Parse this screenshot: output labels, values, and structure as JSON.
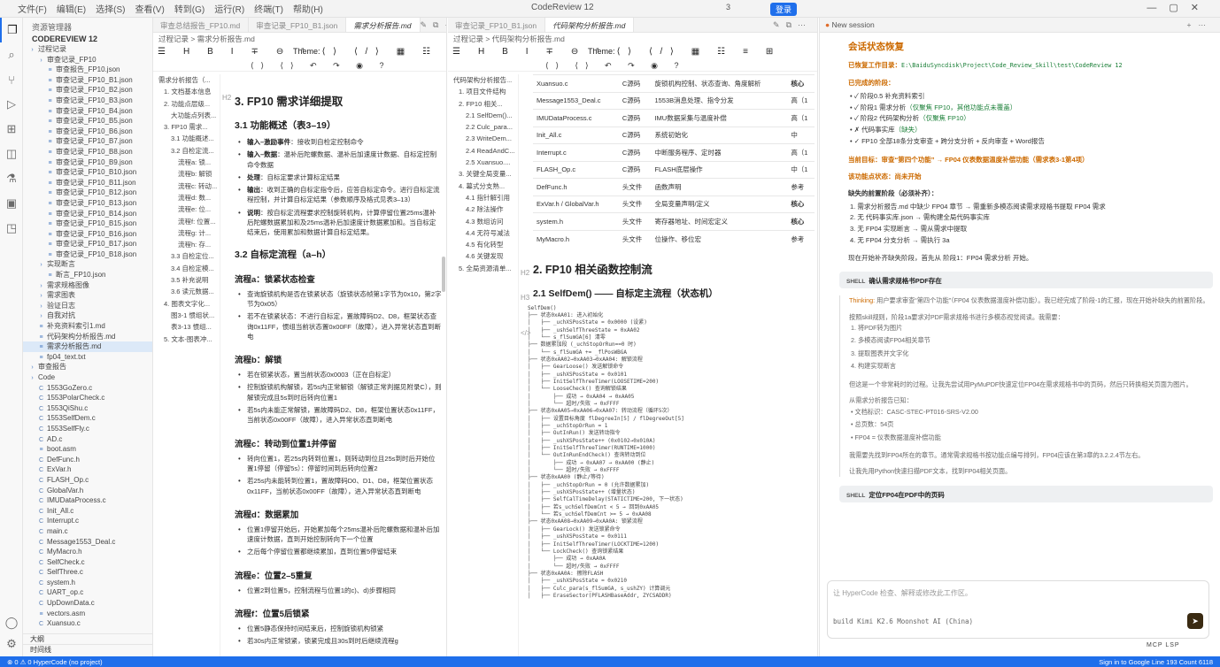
{
  "titlebar": {
    "menus": [
      "文件(F)",
      "编辑(E)",
      "选择(S)",
      "查看(V)",
      "转到(G)",
      "运行(R)",
      "终端(T)",
      "帮助(H)"
    ],
    "title": "CodeReview 12",
    "ext_count": "3",
    "badge": "登录"
  },
  "explorer": {
    "header": "资源管理器",
    "workspace": "CODEREVIEW 12",
    "tree": [
      {
        "label": "过程记录",
        "indent": 0,
        "kind": "folder"
      },
      {
        "label": "审查记录_FP10",
        "indent": 1,
        "kind": "folder"
      },
      {
        "label": "审查报告_FP10.json",
        "indent": 2,
        "kind": "file"
      },
      {
        "label": "审查记录_FP10_B1.json",
        "indent": 2,
        "kind": "file"
      },
      {
        "label": "审查记录_FP10_B2.json",
        "indent": 2,
        "kind": "file"
      },
      {
        "label": "审查记录_FP10_B3.json",
        "indent": 2,
        "kind": "file"
      },
      {
        "label": "审查记录_FP10_B4.json",
        "indent": 2,
        "kind": "file"
      },
      {
        "label": "审查记录_FP10_B5.json",
        "indent": 2,
        "kind": "file"
      },
      {
        "label": "审查记录_FP10_B6.json",
        "indent": 2,
        "kind": "file"
      },
      {
        "label": "审查记录_FP10_B7.json",
        "indent": 2,
        "kind": "file"
      },
      {
        "label": "审查记录_FP10_B8.json",
        "indent": 2,
        "kind": "file"
      },
      {
        "label": "审查记录_FP10_B9.json",
        "indent": 2,
        "kind": "file"
      },
      {
        "label": "审查记录_FP10_B10.json",
        "indent": 2,
        "kind": "file"
      },
      {
        "label": "审查记录_FP10_B11.json",
        "indent": 2,
        "kind": "file"
      },
      {
        "label": "审查记录_FP10_B12.json",
        "indent": 2,
        "kind": "file"
      },
      {
        "label": "审查记录_FP10_B13.json",
        "indent": 2,
        "kind": "file"
      },
      {
        "label": "审查记录_FP10_B14.json",
        "indent": 2,
        "kind": "file"
      },
      {
        "label": "审查记录_FP10_B15.json",
        "indent": 2,
        "kind": "file"
      },
      {
        "label": "审查记录_FP10_B16.json",
        "indent": 2,
        "kind": "file"
      },
      {
        "label": "审查记录_FP10_B17.json",
        "indent": 2,
        "kind": "file"
      },
      {
        "label": "审查记录_FP10_B18.json",
        "indent": 2,
        "kind": "file"
      },
      {
        "label": "实现断言",
        "indent": 1,
        "kind": "folder"
      },
      {
        "label": "断言_FP10.json",
        "indent": 2,
        "kind": "file"
      },
      {
        "label": "需求规格图像",
        "indent": 1,
        "kind": "folder"
      },
      {
        "label": "需求图表",
        "indent": 1,
        "kind": "folder"
      },
      {
        "label": "验证日志",
        "indent": 1,
        "kind": "folder"
      },
      {
        "label": "自我对抗",
        "indent": 1,
        "kind": "folder"
      },
      {
        "label": "补充资料索引1.md",
        "indent": 1,
        "kind": "file"
      },
      {
        "label": "代码架构分析报告.md",
        "indent": 1,
        "kind": "file"
      },
      {
        "label": "需求分析报告.md",
        "indent": 1,
        "kind": "file",
        "selected": true
      },
      {
        "label": "fp04_text.txt",
        "indent": 1,
        "kind": "file"
      },
      {
        "label": "审查报告",
        "indent": 0,
        "kind": "folder"
      },
      {
        "label": "Code",
        "indent": 0,
        "kind": "folder"
      },
      {
        "label": "1553GoZero.c",
        "indent": 1,
        "kind": "c"
      },
      {
        "label": "1553PolarCheck.c",
        "indent": 1,
        "kind": "c"
      },
      {
        "label": "1553QiShu.c",
        "indent": 1,
        "kind": "c"
      },
      {
        "label": "1553SelfDem.c",
        "indent": 1,
        "kind": "c"
      },
      {
        "label": "1553SelfFly.c",
        "indent": 1,
        "kind": "c"
      },
      {
        "label": "AD.c",
        "indent": 1,
        "kind": "c"
      },
      {
        "label": "boot.asm",
        "indent": 1,
        "kind": "file"
      },
      {
        "label": "DefFunc.h",
        "indent": 1,
        "kind": "c"
      },
      {
        "label": "ExVar.h",
        "indent": 1,
        "kind": "c"
      },
      {
        "label": "FLASH_Op.c",
        "indent": 1,
        "kind": "c"
      },
      {
        "label": "GlobalVar.h",
        "indent": 1,
        "kind": "c"
      },
      {
        "label": "IMUDataProcess.c",
        "indent": 1,
        "kind": "c"
      },
      {
        "label": "Init_All.c",
        "indent": 1,
        "kind": "c"
      },
      {
        "label": "Interrupt.c",
        "indent": 1,
        "kind": "c"
      },
      {
        "label": "main.c",
        "indent": 1,
        "kind": "c"
      },
      {
        "label": "Message1553_Deal.c",
        "indent": 1,
        "kind": "c"
      },
      {
        "label": "MyMacro.h",
        "indent": 1,
        "kind": "c"
      },
      {
        "label": "SelfCheck.c",
        "indent": 1,
        "kind": "c"
      },
      {
        "label": "SelfThree.c",
        "indent": 1,
        "kind": "c"
      },
      {
        "label": "system.h",
        "indent": 1,
        "kind": "c"
      },
      {
        "label": "UART_op.c",
        "indent": 1,
        "kind": "c"
      },
      {
        "label": "UpDownData.c",
        "indent": 1,
        "kind": "c"
      },
      {
        "label": "vectors.asm",
        "indent": 1,
        "kind": "file"
      },
      {
        "label": "Xuansuo.c",
        "indent": 1,
        "kind": "c"
      }
    ],
    "sections": [
      "大纲",
      "时间线"
    ]
  },
  "editor1": {
    "tabs": [
      "审查总结报告_FP10.md",
      "审查记录_FP10_B1.json",
      "需求分析报告.md"
    ],
    "breadcrumb": "过程记录 > 需求分析报告.md",
    "theme_label": "Theme:",
    "toolbar_row1": "☰ H B I ∓ ⊖ “ ⟨⟩ ⟨/⟩ ▦ ☷ ≡ ⊞",
    "toolbar_row2": "⟨⟩ ⟨⟩ ↶ ↷ ◉ ?",
    "outline": [
      "需求分析报告（...",
      "1. 文档基本信息",
      "2. 功能点层级...",
      "大功能点列表...",
      "3. FP10 需求...",
      "3.1 功能概述...",
      "3.2 自检定流...",
      "流程a: 锁...",
      "流程b: 解锁",
      "流程c: 转动...",
      "流程d: 数...",
      "流程e: 位...",
      "流程f: 位置...",
      "流程g: 计...",
      "流程h: 存...",
      "3.3 自检定位...",
      "3.4 自检定模...",
      "3.5 补充说明",
      "3.6 读元数据...",
      "4. 图表文字化...",
      "图3-1 惯组状...",
      "表3-13 惯组...",
      "5. 文本-图表冲..."
    ],
    "heading_main": "3. FP10 需求详细提取",
    "heading_sub1": "3.1 功能概述（表3–19）",
    "overview": [
      {
        "k": "输入–激励事件",
        "v": "：接收到自检定控制命令"
      },
      {
        "k": "输入–数据",
        "v": "：温补后陀螺数据、温补后加速度计数据、自标定控制命令数据"
      },
      {
        "k": "处理",
        "v": "：自标定要求计算标定结果"
      },
      {
        "k": "输出",
        "v": "：收到正确的自标定指令后，应答自标定命令。进行自标定流程控制，并计算自标定结果（参数顺序及格式见表3–13）"
      },
      {
        "k": "说明",
        "v": "：按自标定流程要求控制旋转机构，计算停留位置25ms温补后陀螺数据累加和及25ms温补后加速度计数据累加和。当自标定结束后，使用累加和数据计算自标定结果。"
      }
    ],
    "heading_sub2": "3.2 自标定流程（a–h）",
    "flows": [
      {
        "title": "流程a：锁紧状态检查",
        "items": [
          "查询旋锁机构是否在锁紧状态（旋锁状态帧第1字节为0x10，第2字节为0x05）",
          "若不在锁紧状态：不进行自标定，置故障码D2、D8，框架状态查询0x11FF，惯组当前状态置0x00FF（故障），进入异常状态直到断电"
        ]
      },
      {
        "title": "流程b：解锁",
        "items": [
          "若在锁紧状态，置当前状态0x0003（正在自标定）",
          "控制旋锁机构解锁，若5s内正常解锁（解锁正常判据见附录C），则解锁完成且5s到时后转向位置1",
          "若5s内未能正常解锁，置故障码D2、D8，框架位置状态0x11FF，当前状态0x00FF（故障），进入异常状态直到断电"
        ]
      },
      {
        "title": "流程c：转动到位置1并停留",
        "items": [
          "转向位置1，若25s内转到位置1，则转动到位且25s到时后开始位置1停留（停留5s）：停留时间到后转向位置2",
          "若25s内未能转到位置1，置故障码D0、D1、D8，框架位置状态0x11FF，当前状态0x00FF（故障），进入异常状态直到断电"
        ]
      },
      {
        "title": "流程d：数据累加",
        "items": [
          "位置1停留开始后，开始累加每个25ms温补后陀螺数据和温补后加速度计数据，直到开始控制转向下一个位置",
          "之后每个停留位置都继续累加，直到位置5停留结束"
        ]
      },
      {
        "title": "流程e：位置2–5重复",
        "items": [
          "位置2到位置5，控制流程与位置1的c)、d)步骤相同"
        ]
      },
      {
        "title": "流程f：位置5后锁紧",
        "items": [
          "位置5静态保持时间结束后，控制旋锁机构锁紧",
          "若30s内正常锁紧，锁紧完成且30s到时后继续流程g"
        ]
      }
    ]
  },
  "editor2": {
    "tabs": [
      "审查记录_FP10_B1.json",
      "代码架构分析报告.md"
    ],
    "breadcrumb": "过程记录 > 代码架构分析报告.md",
    "outline": [
      "代码架构分析报告...",
      "1. 项目文件结构",
      "2. FP10 相关...",
      "2.1 SelfDem()...",
      "2.2 Culc_para...",
      "2.3 WriteDem...",
      "2.4 ReadAndC...",
      "2.5 Xuansuo....",
      "3. 关键全局变量...",
      "4. 幕式分支熟...",
      "4.1 指针解引用",
      "4.2 除法操作",
      "4.3 数组访问",
      "4.4 无符号减法",
      "4.5 有化转型",
      "4.6 关键发现",
      "5. 全局资源清单..."
    ],
    "table_rows": [
      [
        "Xuansuo.c",
        "C源码",
        "旋锁机构控制、状态查询、角度解析",
        "核心"
      ],
      [
        "Message1553_Deal.c",
        "C源码",
        "1553B消息处理、指令分发",
        "高（1"
      ],
      [
        "IMUDataProcess.c",
        "C源码",
        "IMU数据采集与温度补偿",
        "高（1"
      ],
      [
        "Init_All.c",
        "C源码",
        "系统初始化",
        "中"
      ],
      [
        "Interrupt.c",
        "C源码",
        "中断服务程序、定时器",
        "高（1"
      ],
      [
        "FLASH_Op.c",
        "C源码",
        "FLASH底层操作",
        "中（1"
      ],
      [
        "DefFunc.h",
        "头文件",
        "函数声明",
        "参考"
      ],
      [
        "ExVar.h / GlobalVar.h",
        "头文件",
        "全局变量声明/定义",
        "核心"
      ],
      [
        "system.h",
        "头文件",
        "寄存器地址、时间宏定义",
        "核心"
      ],
      [
        "MyMacro.h",
        "头文件",
        "位操作、移位宏",
        "参考"
      ]
    ],
    "heading_2": "2. FP10 相关函数控制流",
    "heading_21": "2.1 SelfDem() —— 自标定主流程（状态机）",
    "code": "SelfDem()\n├── 状态0xAA01: 进入初始化\n│   ├── _uchXSPosState = 0x0000 (设紧)\n│   ├── _ushSelfThreeState = 0xAA02\n│   └── s_flSumGA[6] 清零\n├── 数据累加段 (_uchStopOrRun==0 时)\n│   └── s_flSumGA += _flPosWBGA\n├── 状态0xAA02→0xAA03→0xAA04: 解锁流程\n│   ├── GearLoose() 发送解锁命令\n│   ├── _ushXSPosState = 0x0101\n│   ├── InitSelfThreeTimer(LOOSETIME=200)\n│   └── LooseCheck() 查询解锁结果\n│       ├── 成功 → 0xAA04 → 0xAA05\n│       └── 超时/失败 → 0xFFFF\n├── 状态0xAA05→0xAA06→0xAA07: 转动流程（循环5次）\n│   ├── 设置目标角度 flDegreeIn[5] / flDegreeOut[5]\n│   ├── _uchStopOrRun = 1\n│   ├── OutInRun() 发送转动指令\n│   ├── _ushXSPosState++ (0x0102→0x010A)\n│   ├── InitSelfThreeTimer(RUNTIME=1000)\n│   └── OutInRunEndCheck() 查询转动到位\n│       ├── 成功 → 0xAA07 → 0xAA00 (静止)\n│       └── 超时/失败 → 0xFFFF\n├── 状态0xAA00 (静止/等待)\n│   ├── _uchStopOrRun = 0 (允许数据累加)\n│   ├── _ushXSPosState++ (增量状态)\n│   ├── SelfCalTimeDelay(STATICTIME=200, 下一状态)\n│   ├── 若s_uchSelfDemCnt < 5 → 回到0xAA05\n│   └── 若s_uchSelfDemCnt >= 5 → 0xAA08\n├── 状态0xAA08→0xAA09→0xAA0A: 锁紧流程\n│   ├── GearLock() 发送锁紧命令\n│   ├── _ushXSPosState = 0x0111\n│   ├── InitSelfThreeTimer(LOCKTIME=1200)\n│   └── LockCheck() 查询锁紧结果\n│       ├── 成功 → 0xAA0A\n│       └── 超时/失败 → 0xFFFF\n├── 状态0xAA0A: 擦除FLASH\n│   ├── _ushXSPosState = 0x0210\n│   ├── Culc_para(s_flSumGA, s_ushZY) 计算调元\n│   ├── EraseSector(PFLASHBaseAddr, ZYCSADDR)"
  },
  "chat": {
    "tab": "New session",
    "title": "会话状态恢复",
    "workdir_label": "已恢复工作目录：",
    "workdir": "E:\\BaiduSyncdisk\\Project\\Code_Review_Skill\\test\\CodeReview 12",
    "done_label": "已完成的阶段：",
    "stages": [
      "✓ 阶段0.5 补充资料索引",
      "✓ 阶段1 需求分析（仅聚焦 FP10，其他功能点未覆盖）",
      "✓ 阶段2 代码架构分析（仅聚焦 FP10）",
      "✗ 代码事实库（缺失）",
      "✓ FP10 全部18条分支审查 + 跨分支分析 + 反向审查 + Word报告"
    ],
    "current": "当前目标：审查“第四个功能” → FP04 仪表数据温度补偿功能（需求表3-1第4项）",
    "status": "该功能点状态：尚未开始",
    "missing_label": "缺失的前置阶段（必须补齐）：",
    "missing": [
      "1. 需求分析报告.md 中缺少 FP04 章节 → 需重新多模态阅读需求规格书提取 FP04 需求",
      "2. 无 代码事实库.json → 需构建全局代码事实库",
      "3. 无 FP04 实现断言 → 需从需求中提取",
      "4. 无 FP04 分支分析 → 需执行 3a"
    ],
    "plan": "现在开始补齐缺失阶段，首先从 阶段1：FP04 需求分析 开始。",
    "shell_label": "SHELL",
    "shell1": "确认需求规格书PDF存在",
    "thinking_label": "Thinking:",
    "thinking": "用户要求审查“第四个功能”（FP04 仪表数据温度补偿功能）。我已经完成了阶段-1的汇报，现在开始补缺失的前置阶段。",
    "think2": "按照skill规则，阶段1a要求对PDF需求规格书进行多模态视觉阅读。我需要：",
    "think_steps": [
      "1. 将PDF转为图片",
      "2. 多模态阅读FP04相关章节",
      "3. 提取图表并文字化",
      "4. 构建实现断言"
    ],
    "think3": "但这是一个非常耗时的过程。让我先尝试用PyMuPDF快速定位FP04在需求规格书中的页码，然后只转换相关页面为图片。",
    "think4": "从需求分析报告已知：",
    "think_facts": [
      "• 文档标识：CASC-STEC-PT016-SRS-V2.00",
      "• 总页数：54页",
      "• FP04 = 仪表数据温度补偿功能"
    ],
    "think5": "我需要先找到FP04所在的章节。通常需求规格书按功能点编号排列，FP04应该在第3章的3.2.2.4节左右。",
    "think6": "让我先用Python快速扫描PDF文本，找到FP04相关页面。",
    "shell2": "定位FP04在PDF中的页码",
    "input_placeholder": "让 HyperCode 检查、解释或修改此工作区。",
    "model": "build Kimi K2.6 Moonshot AI (China)",
    "bottom": "MCP   LSP"
  },
  "statusbar": {
    "left": "⊗ 0 ⚠ 0   HyperCode   (no project)",
    "right": "Sign in to Google   Line 193   Count 6118"
  }
}
